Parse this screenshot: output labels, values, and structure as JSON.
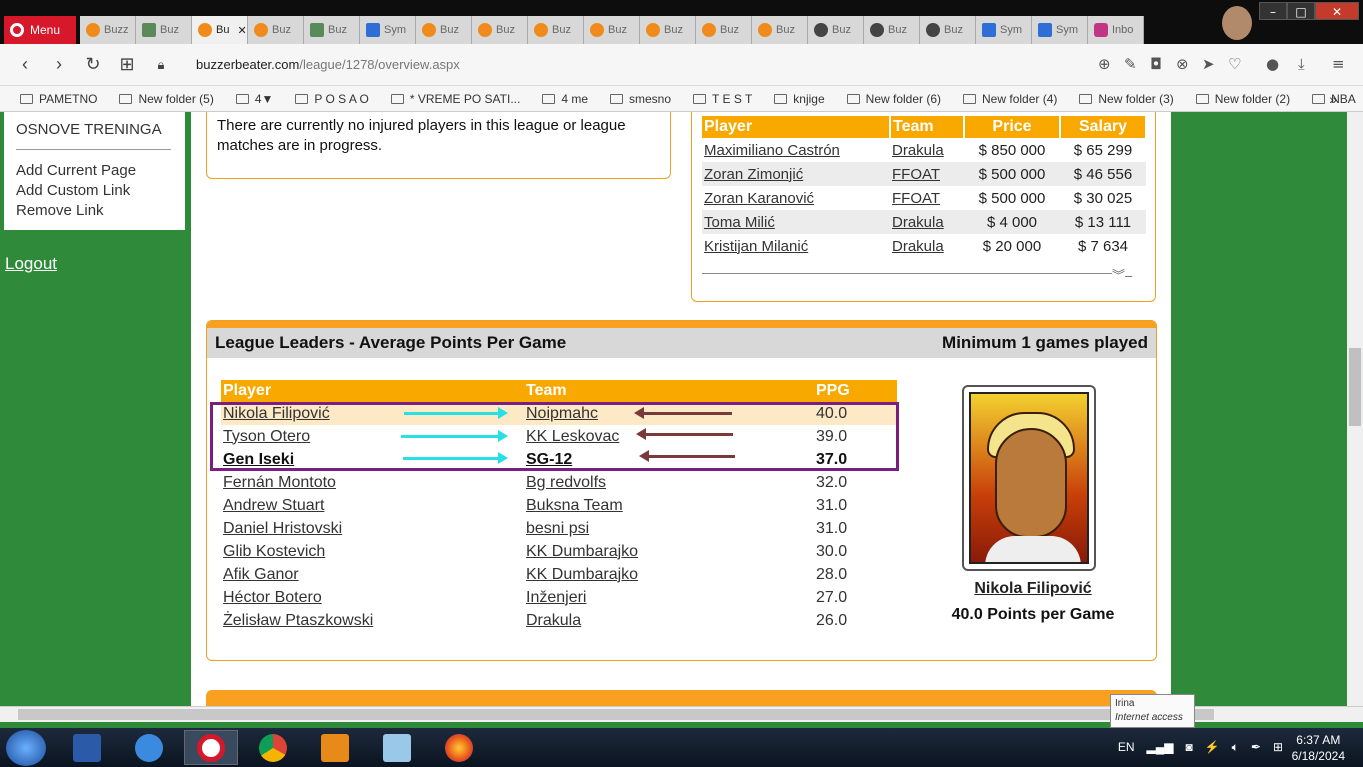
{
  "browser": {
    "menu_label": "Menu",
    "tabs": [
      {
        "label": "Buzz",
        "icon": "basketball-icon"
      },
      {
        "label": "Buz",
        "icon": "bm-icon"
      },
      {
        "label": "Bu",
        "icon": "basketball-icon",
        "active": true
      },
      {
        "label": "Buz",
        "icon": "basketball-icon"
      },
      {
        "label": "Buz",
        "icon": "bm-icon"
      },
      {
        "label": "Sym",
        "icon": "sym-icon"
      },
      {
        "label": "Buz",
        "icon": "basketball-icon"
      },
      {
        "label": "Buz",
        "icon": "basketball-icon"
      },
      {
        "label": "Buz",
        "icon": "basketball-icon"
      },
      {
        "label": "Buz",
        "icon": "basketball-icon"
      },
      {
        "label": "Buz",
        "icon": "basketball-icon"
      },
      {
        "label": "Buz",
        "icon": "basketball-icon"
      },
      {
        "label": "Buz",
        "icon": "basketball-icon"
      },
      {
        "label": "Buz",
        "icon": "globe-icon"
      },
      {
        "label": "Buz",
        "icon": "globe-icon"
      },
      {
        "label": "Buz",
        "icon": "globe-icon"
      },
      {
        "label": "Sym",
        "icon": "sym-icon"
      },
      {
        "label": "Sym",
        "icon": "sym-icon"
      },
      {
        "label": "Inbo",
        "icon": "instagram-icon"
      }
    ],
    "url_host": "buzzerbeater.com",
    "url_path": "/league/1278/overview.aspx",
    "bookmarks": [
      "PAMETNO",
      "New folder (5)",
      "4▼",
      "P O S A O",
      "*   VREME PO SATI...",
      "4 me",
      "smesno",
      "T E S T",
      "knjige",
      "New folder (6)",
      "New folder (4)",
      "New folder (3)",
      "New folder (2)",
      "NBA"
    ]
  },
  "sidebar": {
    "title": "OSNOVE TRENINGA",
    "links": [
      "Add Current Page",
      "Add Custom Link",
      "Remove Link"
    ],
    "logout": "Logout"
  },
  "injury": {
    "text": "There are currently no injured players in this league or league matches are in progress."
  },
  "transfers": {
    "headers": [
      "Player",
      "Team",
      "Price",
      "Salary"
    ],
    "rows": [
      {
        "player": "Maximiliano Castrón",
        "team": "Drakula",
        "price": "$ 850 000",
        "salary": "$ 65 299"
      },
      {
        "player": "Zoran Zimonjić",
        "team": "FFOAT",
        "price": "$ 500 000",
        "salary": "$ 46 556"
      },
      {
        "player": "Zoran Karanović",
        "team": "FFOAT",
        "price": "$ 500 000",
        "salary": "$ 30 025"
      },
      {
        "player": "Toma Milić",
        "team": "Drakula",
        "price": "$ 4 000",
        "salary": "$ 13 111"
      },
      {
        "player": "Kristijan Milanić",
        "team": "Drakula",
        "price": "$ 20 000",
        "salary": "$ 7 634"
      }
    ]
  },
  "leaders": {
    "title": "League Leaders - Average Points Per Game",
    "subtitle": "Minimum 1 games played",
    "headers": [
      "Player",
      "Team",
      "PPG"
    ],
    "rows": [
      {
        "player": "Nikola Filipović",
        "team": "Noipmahc",
        "ppg": "40.0"
      },
      {
        "player": "Tyson Otero",
        "team": "KK Leskovac",
        "ppg": "39.0"
      },
      {
        "player": "Gen Iseki",
        "team": "SG-12",
        "ppg": "37.0"
      },
      {
        "player": "Fernán Montoto",
        "team": "Bg redvolfs",
        "ppg": "32.0"
      },
      {
        "player": "Andrew Stuart",
        "team": "Buksna Team",
        "ppg": "31.0"
      },
      {
        "player": "Daniel Hristovski",
        "team": "besni psi",
        "ppg": "31.0"
      },
      {
        "player": "Glib Kostevich",
        "team": "KK Dumbarajko",
        "ppg": "30.0"
      },
      {
        "player": "Afik Ganor",
        "team": "KK Dumbarajko",
        "ppg": "28.0"
      },
      {
        "player": "Héctor Botero",
        "team": "Inženjeri",
        "ppg": "27.0"
      },
      {
        "player": "Żelisław Ptaszkowski",
        "team": "Drakula",
        "ppg": "26.0"
      }
    ],
    "top_name": "Nikola Filipović",
    "top_stat": "40.0 Points per Game"
  },
  "tooltip": {
    "name": "Irina",
    "status": "Internet access"
  },
  "system": {
    "lang": "EN",
    "time": "6:37 AM",
    "date": "6/18/2024"
  },
  "colors": {
    "accent": "#f9a800",
    "page_bg": "#2f8a3a",
    "highlight_box": "#7a1f80",
    "arrow_cyan": "#26e0e6",
    "arrow_brown": "#7a3a3a"
  }
}
